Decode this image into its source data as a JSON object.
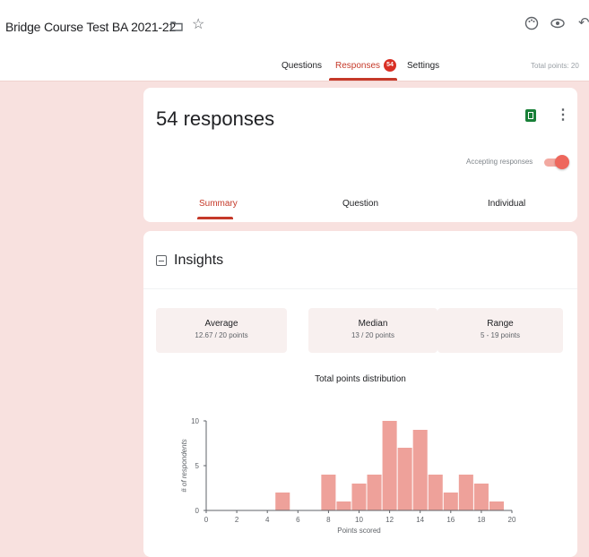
{
  "header": {
    "doc_title": "Bridge Course Test BA 2021-22",
    "icons": [
      "folder-icon",
      "star-icon",
      "palette-icon",
      "eye-icon",
      "undo-icon"
    ]
  },
  "tabs": {
    "questions": "Questions",
    "responses": "Responses",
    "responses_badge": "54",
    "settings": "Settings",
    "total_points": "Total points: 20"
  },
  "summary_card": {
    "title": "54 responses",
    "accepting_label": "Accepting responses",
    "accepting_on": true,
    "subtabs": [
      "Summary",
      "Question",
      "Individual"
    ],
    "active_subtab": "Summary"
  },
  "insights": {
    "title": "Insights",
    "stats": [
      {
        "label": "Average",
        "value": "12.67 / 20 points"
      },
      {
        "label": "Median",
        "value": "13 / 20 points"
      },
      {
        "label": "Range",
        "value": "5 - 19 points"
      }
    ]
  },
  "colors": {
    "accent": "#c53929",
    "bar": "#eea19a",
    "background": "#f8e1df"
  },
  "chart_data": {
    "type": "bar",
    "title": "Total points distribution",
    "xlabel": "Points scored",
    "ylabel": "# of respondents",
    "x": [
      5,
      8,
      9,
      10,
      11,
      12,
      13,
      14,
      15,
      16,
      17,
      18,
      19
    ],
    "values": [
      2,
      4,
      1,
      3,
      4,
      10,
      7,
      9,
      4,
      2,
      4,
      3,
      1
    ],
    "xlim": [
      0,
      20
    ],
    "ylim": [
      0,
      10
    ],
    "xticks": [
      0,
      2,
      4,
      6,
      8,
      10,
      12,
      14,
      16,
      18,
      20
    ],
    "yticks": [
      0,
      5,
      10
    ]
  }
}
